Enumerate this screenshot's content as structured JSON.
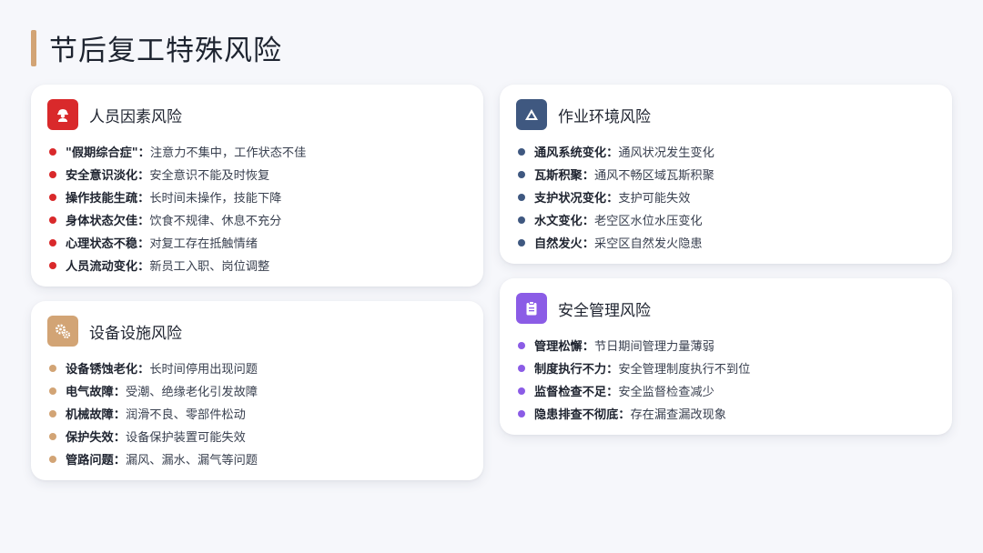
{
  "page": {
    "title": "节后复工特殊风险"
  },
  "colors": {
    "accent": "#d2a475",
    "people": "#d9292b",
    "equip": "#d2a475",
    "env": "#3f5880",
    "mgmt": "#8b5ce6"
  },
  "cards": {
    "people": {
      "title": "人员因素风险",
      "icon": "worker-icon",
      "items": [
        {
          "term": "\"假期综合症\"：",
          "desc": "注意力不集中，工作状态不佳"
        },
        {
          "term": "安全意识淡化：",
          "desc": "安全意识不能及时恢复"
        },
        {
          "term": "操作技能生疏：",
          "desc": "长时间未操作，技能下降"
        },
        {
          "term": "身体状态欠佳：",
          "desc": "饮食不规律、休息不充分"
        },
        {
          "term": "心理状态不稳：",
          "desc": "对复工存在抵触情绪"
        },
        {
          "term": "人员流动变化：",
          "desc": "新员工入职、岗位调整"
        }
      ]
    },
    "equip": {
      "title": "设备设施风险",
      "icon": "gears-icon",
      "items": [
        {
          "term": "设备锈蚀老化：",
          "desc": "长时间停用出现问题"
        },
        {
          "term": "电气故障：",
          "desc": "受潮、绝缘老化引发故障"
        },
        {
          "term": "机械故障：",
          "desc": "润滑不良、零部件松动"
        },
        {
          "term": "保护失效：",
          "desc": "设备保护装置可能失效"
        },
        {
          "term": "管路问题：",
          "desc": "漏风、漏水、漏气等问题"
        }
      ]
    },
    "env": {
      "title": "作业环境风险",
      "icon": "mountain-icon",
      "items": [
        {
          "term": "通风系统变化：",
          "desc": "通风状况发生变化"
        },
        {
          "term": "瓦斯积聚：",
          "desc": "通风不畅区域瓦斯积聚"
        },
        {
          "term": "支护状况变化：",
          "desc": "支护可能失效"
        },
        {
          "term": "水文变化：",
          "desc": "老空区水位水压变化"
        },
        {
          "term": "自然发火：",
          "desc": "采空区自然发火隐患"
        }
      ]
    },
    "mgmt": {
      "title": "安全管理风险",
      "icon": "clipboard-icon",
      "items": [
        {
          "term": "管理松懈：",
          "desc": "节日期间管理力量薄弱"
        },
        {
          "term": "制度执行不力：",
          "desc": "安全管理制度执行不到位"
        },
        {
          "term": "监督检查不足：",
          "desc": "安全监督检查减少"
        },
        {
          "term": "隐患排查不彻底：",
          "desc": "存在漏查漏改现象"
        }
      ]
    }
  }
}
